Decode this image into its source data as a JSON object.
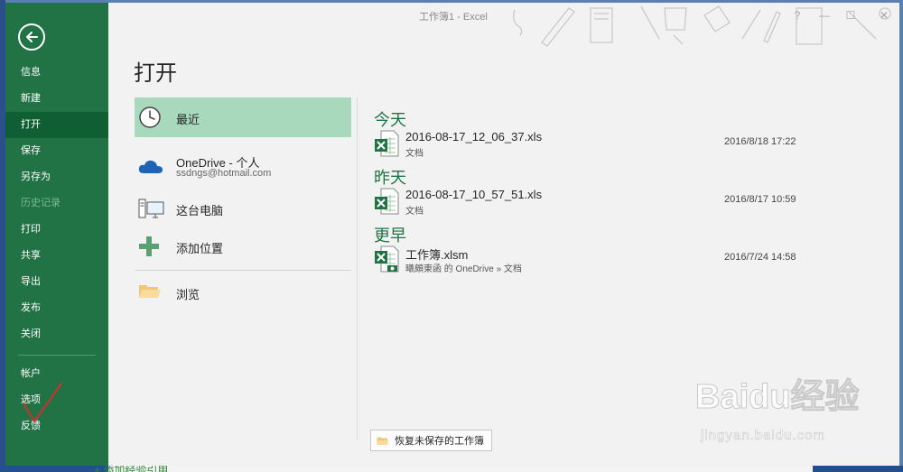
{
  "window": {
    "title": "工作簿1 - Excel",
    "controls": {
      "help": "?",
      "minimize": "—",
      "restore": "☐",
      "close": "✕"
    }
  },
  "sidebar": {
    "back_icon": "back-arrow-icon",
    "items": [
      {
        "label": "信息"
      },
      {
        "label": "新建"
      },
      {
        "label": "打开"
      },
      {
        "label": "保存"
      },
      {
        "label": "另存为"
      },
      {
        "label": "历史记录"
      },
      {
        "label": "打印"
      },
      {
        "label": "共享"
      },
      {
        "label": "导出"
      },
      {
        "label": "发布"
      },
      {
        "label": "关闭"
      }
    ],
    "bottom_items": [
      {
        "label": "帐户"
      },
      {
        "label": "选项"
      },
      {
        "label": "反馈"
      }
    ],
    "active": "打开",
    "disabled": "历史记录"
  },
  "page": {
    "heading": "打开"
  },
  "locations": [
    {
      "label": "最近",
      "icon": "clock-icon"
    },
    {
      "label": "OneDrive - 个人",
      "sub": "ssdngs@hotmail.com",
      "icon": "onedrive-cloud-icon"
    },
    {
      "label": "这台电脑",
      "icon": "computer-icon"
    },
    {
      "label": "添加位置",
      "icon": "add-plus-icon"
    },
    {
      "label": "浏览",
      "icon": "folder-icon"
    }
  ],
  "recent": {
    "groups": [
      {
        "title": "今天",
        "files": [
          {
            "name": "2016-08-17_12_06_37.xls",
            "path": "文档",
            "date": "2016/8/18 17:22",
            "icon": "excel-file-icon"
          }
        ]
      },
      {
        "title": "昨天",
        "files": [
          {
            "name": "2016-08-17_10_57_51.xls",
            "path": "文档",
            "date": "2016/8/17 10:59",
            "icon": "excel-file-icon"
          }
        ]
      },
      {
        "title": "更早",
        "files": [
          {
            "name": "工作簿.xlsm",
            "path": "曦頗東函 的 OneDrive » 文档",
            "date": "2016/7/24 14:58",
            "icon": "excel-macro-file-icon"
          }
        ]
      }
    ],
    "recover_button": "恢复未保存的工作簿"
  },
  "desktop": {
    "bottom_text": "+ 添加经验引用"
  },
  "watermark": {
    "brand": "Baidu经验",
    "url": "jingyan.baidu.com"
  },
  "colors": {
    "accent": "#217346",
    "accent_dark": "#0f5e34",
    "selected": "#a9d9bd",
    "background": "#f2f2f2"
  }
}
